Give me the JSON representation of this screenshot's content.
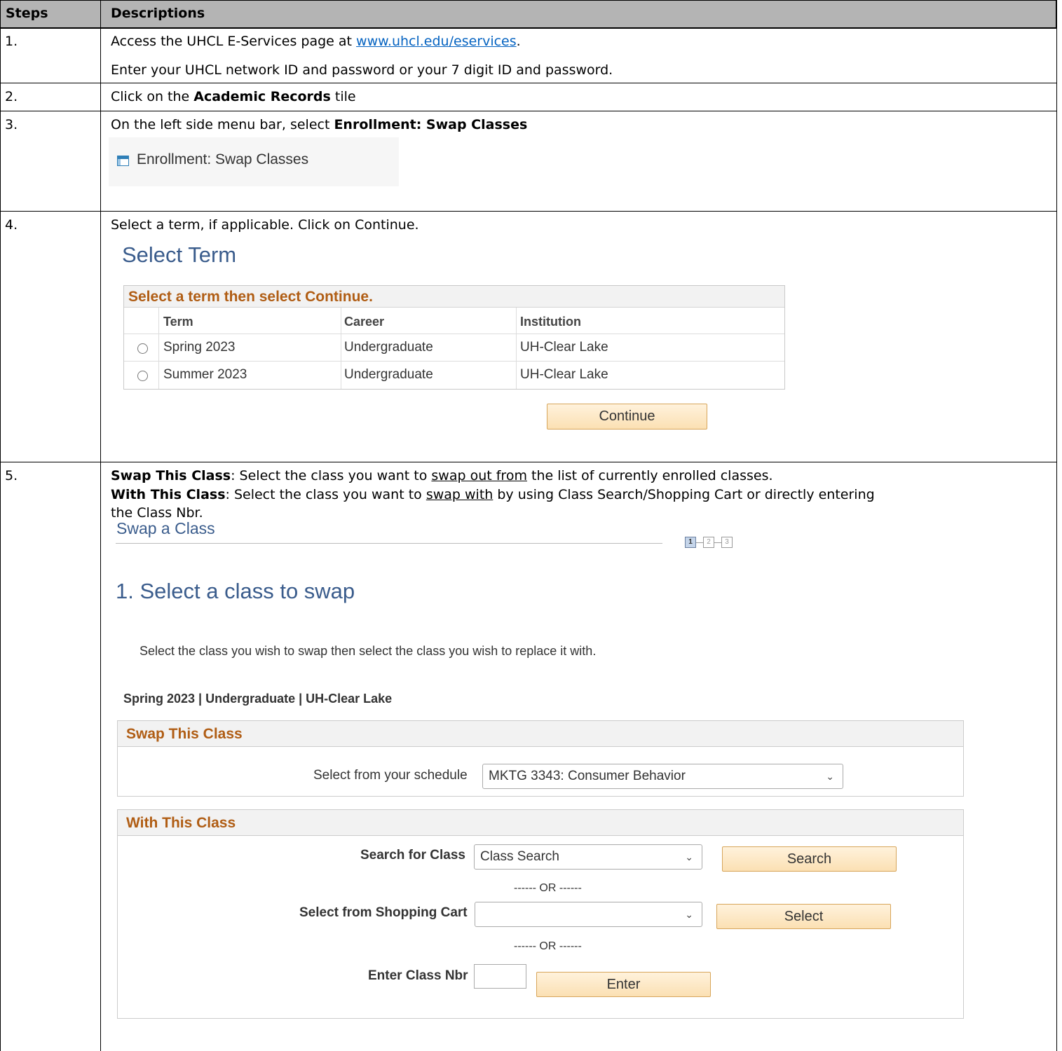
{
  "table": {
    "col_steps": "Steps",
    "col_desc": "Descriptions"
  },
  "step1": {
    "num": "1.",
    "line1_pre": "Access the UHCL E-Services page at ",
    "line1_link": "www.uhcl.edu/eservices",
    "line1_post": ".",
    "line2": "Enter your UHCL network ID and password or your 7 digit ID and password."
  },
  "step2": {
    "num": "2.",
    "pre": "Click on the ",
    "bold": "Academic Records",
    "post": " tile"
  },
  "step3": {
    "num": "3.",
    "pre": "On the left side menu bar, select ",
    "bold": "Enrollment: Swap Classes",
    "menu_item": "Enrollment:  Swap Classes",
    "menu_icon": "grid-page-icon"
  },
  "step4": {
    "num": "4.",
    "text": "Select a term, if applicable. Click on Continue.",
    "heading": "Select Term",
    "box_title": "Select a term then select Continue.",
    "headers": [
      "Term",
      "Career",
      "Institution"
    ],
    "rows": [
      {
        "term": "Spring 2023",
        "career": "Undergraduate",
        "institution": "UH-Clear Lake"
      },
      {
        "term": "Summer 2023",
        "career": "Undergraduate",
        "institution": "UH-Clear Lake"
      }
    ],
    "continue_label": "Continue"
  },
  "step5": {
    "num": "5.",
    "a_bold": "Swap This Class",
    "a_pre": ": Select the class you want to ",
    "a_ul": "swap out from",
    "a_post": " the list of currently enrolled classes.",
    "b_bold": "With This Class",
    "b_pre": ": Select the class you want to ",
    "b_ul": "swap with",
    "b_post": " by using Class Search/Shopping Cart or directly entering",
    "b_line2": "the Class Nbr.",
    "page_title": "Swap a Class",
    "steps": [
      "1",
      "2",
      "3"
    ],
    "section_heading": "1.  Select a class to swap",
    "instructions": "Select the class you wish to swap then select the class you wish to replace it with.",
    "context": "Spring 2023 | Undergraduate | UH-Clear Lake",
    "swap_panel_title": "Swap This Class",
    "schedule_label": "Select from your schedule",
    "schedule_value": "MKTG 3343: Consumer Behavior",
    "with_panel_title": "With This Class",
    "search_label": "Search for Class",
    "search_value": "Class Search",
    "search_btn": "Search",
    "or1": "------ OR ------",
    "cart_label": "Select from Shopping Cart",
    "cart_value": "",
    "select_btn": "Select",
    "or2": "------ OR ------",
    "nbr_label": "Enter Class Nbr",
    "nbr_value": "",
    "enter_btn": "Enter"
  }
}
